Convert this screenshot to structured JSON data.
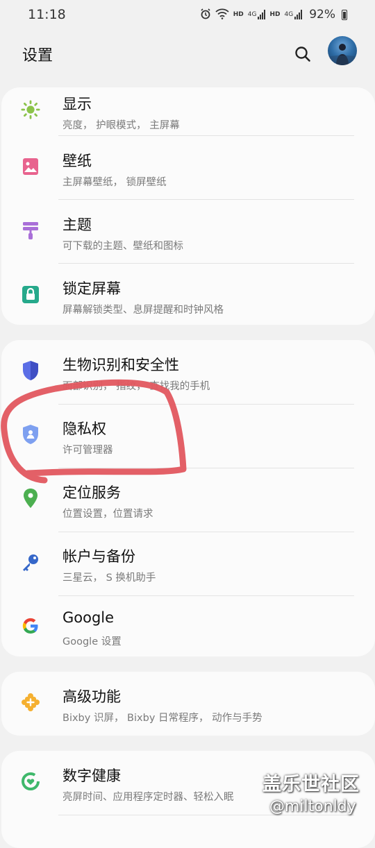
{
  "status": {
    "time": "11:18",
    "hd1": "HD",
    "net1": "4G",
    "hd2": "HD",
    "net2": "4G",
    "battery": "92%"
  },
  "header": {
    "title": "设置",
    "search_icon": "search-icon",
    "avatar_icon": "avatar"
  },
  "groups": [
    {
      "items": [
        {
          "title": "显示",
          "subtitle": "亮度， 护眼模式， 主屏幕",
          "icon": "sun-icon",
          "color": "#8bc34a"
        },
        {
          "title": "壁纸",
          "subtitle": "主屏幕壁纸， 锁屏壁纸",
          "icon": "picture-icon",
          "color": "#e8638e"
        },
        {
          "title": "主题",
          "subtitle": "可下载的主题、壁纸和图标",
          "icon": "paintbrush-icon",
          "color": "#a96fd8"
        },
        {
          "title": "锁定屏幕",
          "subtitle": "屏幕解锁类型、息屏提醒和时钟风格",
          "icon": "lock-icon",
          "color": "#26a98b"
        }
      ]
    },
    {
      "items": [
        {
          "title": "生物识别和安全性",
          "subtitle": "面部识别， 指纹， 查找我的手机",
          "icon": "shield-icon",
          "color": "#5b6ee6"
        },
        {
          "title": "隐私权",
          "subtitle": "许可管理器",
          "icon": "privacy-shield-icon",
          "color": "#6b93ee"
        },
        {
          "title": "定位服务",
          "subtitle": "位置设置，位置请求",
          "icon": "location-pin-icon",
          "color": "#4caf50"
        },
        {
          "title": "帐户与备份",
          "subtitle": "三星云， S 换机助手",
          "icon": "key-icon",
          "color": "#3567c9"
        },
        {
          "title": "Google",
          "subtitle": "Google 设置",
          "icon": "google-icon",
          "color": "#4285f4"
        }
      ]
    },
    {
      "items": [
        {
          "title": "高级功能",
          "subtitle": "Bixby 识屏， Bixby 日常程序， 动作与手势",
          "icon": "puzzle-icon",
          "color": "#f5b030"
        }
      ]
    },
    {
      "items": [
        {
          "title": "数字健康",
          "subtitle": "亮屏时间、应用程序定时器、轻松入眠",
          "icon": "wellbeing-icon",
          "color": "#3fb86b"
        }
      ]
    }
  ],
  "watermark": {
    "line1": "盖乐世社区",
    "line2": "@miltonldy"
  },
  "annotation_color": "#e2575f"
}
